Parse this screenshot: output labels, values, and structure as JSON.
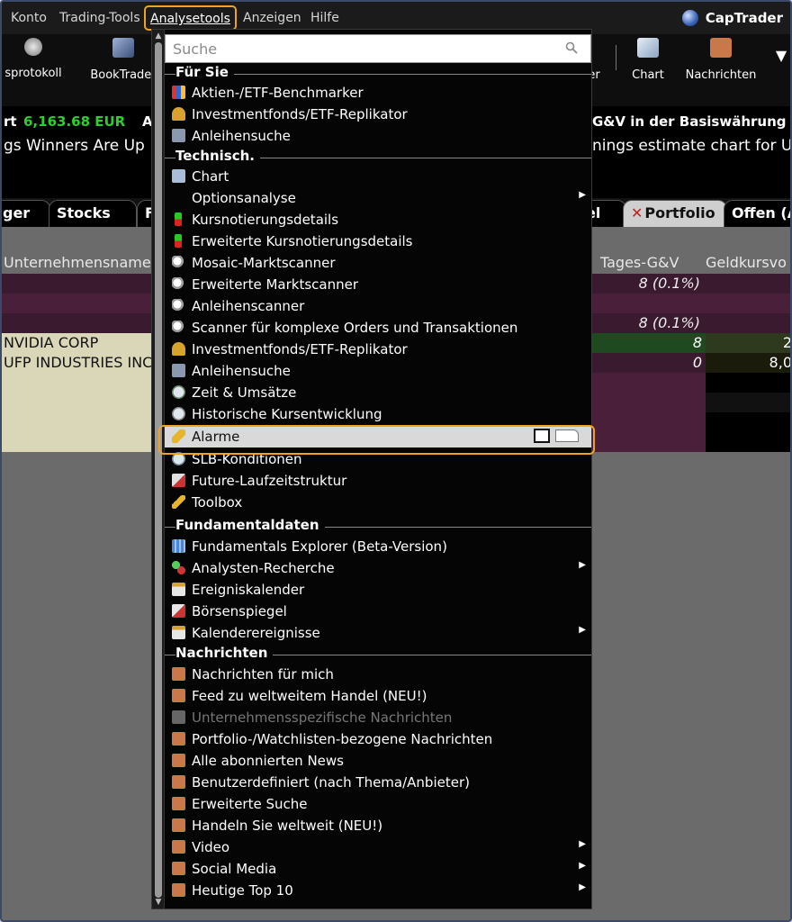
{
  "menubar": {
    "items": [
      "Konto",
      "Trading-Tools",
      "Analysetools",
      "Anzeigen",
      "Hilfe"
    ],
    "brand": "CapTrader"
  },
  "toolbar": {
    "items": [
      "sprotokoll",
      "BookTrader",
      "er",
      "Chart",
      "Nachrichten"
    ],
    "more": "▼"
  },
  "ticker": {
    "line1_left": "rt",
    "line1_value": "6,163.68 EUR",
    "line1_tail": "A",
    "line1_right": "G&V in der Basiswährung",
    "line2_left": "gs Winners Are Up",
    "line2_right": "nings estimate chart for U"
  },
  "tabs": [
    "ger",
    "Stocks",
    "F",
    "el",
    "Portfolio",
    "Offen (A"
  ],
  "grid": {
    "headers": [
      "Unternehmensname",
      "Tages-G&V",
      "Geldkursvo"
    ],
    "rows": [
      {
        "name": "",
        "pnl": "8 (0.1%)",
        "bid": ""
      },
      {
        "name": "",
        "pnl": "",
        "bid": ""
      },
      {
        "name": "",
        "pnl": "8 (0.1%)",
        "bid": ""
      },
      {
        "name": "NVIDIA CORP",
        "pnl": "8",
        "bid": "2"
      },
      {
        "name": "UFP INDUSTRIES INC",
        "pnl": "0",
        "bid": "8,0"
      }
    ]
  },
  "dropdown": {
    "search_placeholder": "Suche",
    "sections": {
      "fuer_sie": "Für Sie",
      "technisch": "Technisch.",
      "fundamental": "Fundamentaldaten",
      "nachrichten": "Nachrichten"
    },
    "items": {
      "aktien_benchmarker": "Aktien-/ETF-Benchmarker",
      "investmentfonds1": "Investmentfonds/ETF-Replikator",
      "anleihensuche1": "Anleihensuche",
      "chart": "Chart",
      "optionsanalyse": "Optionsanalyse",
      "kursnotierung": "Kursnotierungsdetails",
      "erw_kursnotierung": "Erweiterte Kursnotierungsdetails",
      "mosaic_scanner": "Mosaic-Marktscanner",
      "erw_scanner": "Erweiterte Marktscanner",
      "anleihenscanner": "Anleihenscanner",
      "komplex_scanner": "Scanner für komplexe Orders und Transaktionen",
      "investmentfonds2": "Investmentfonds/ETF-Replikator",
      "anleihensuche2": "Anleihensuche",
      "zeit_umsaetze": "Zeit & Umsätze",
      "historisch": "Historische Kursentwicklung",
      "alarme": "Alarme",
      "slb": "SLB-Konditionen",
      "future": "Future-Laufzeitstruktur",
      "toolbox": "Toolbox",
      "fund_explorer": "Fundamentals Explorer (Beta-Version)",
      "analysten": "Analysten-Recherche",
      "ereignis": "Ereigniskalender",
      "boersenspiegel": "Börsenspiegel",
      "kalender": "Kalenderereignisse",
      "news_mich": "Nachrichten für mich",
      "feed_handel": "Feed zu weltweitem Handel (NEU!)",
      "unternehmens_news": "Unternehmensspezifische Nachrichten",
      "portfolio_news": "Portfolio-/Watchlisten-bezogene Nachrichten",
      "alle_news": "Alle abonnierten News",
      "benutzer": "Benutzerdefiniert (nach Thema/Anbieter)",
      "erw_suche": "Erweiterte Suche",
      "handeln": "Handeln Sie weltweit (NEU!)",
      "video": "Video",
      "social": "Social Media",
      "top10": "Heutige Top 10"
    }
  },
  "colors": {
    "accent": "#f0a31e",
    "ticker_value": "#2bd12b",
    "row_maroon": "#3a1a2e",
    "row_cream": "#d9d7b8"
  }
}
